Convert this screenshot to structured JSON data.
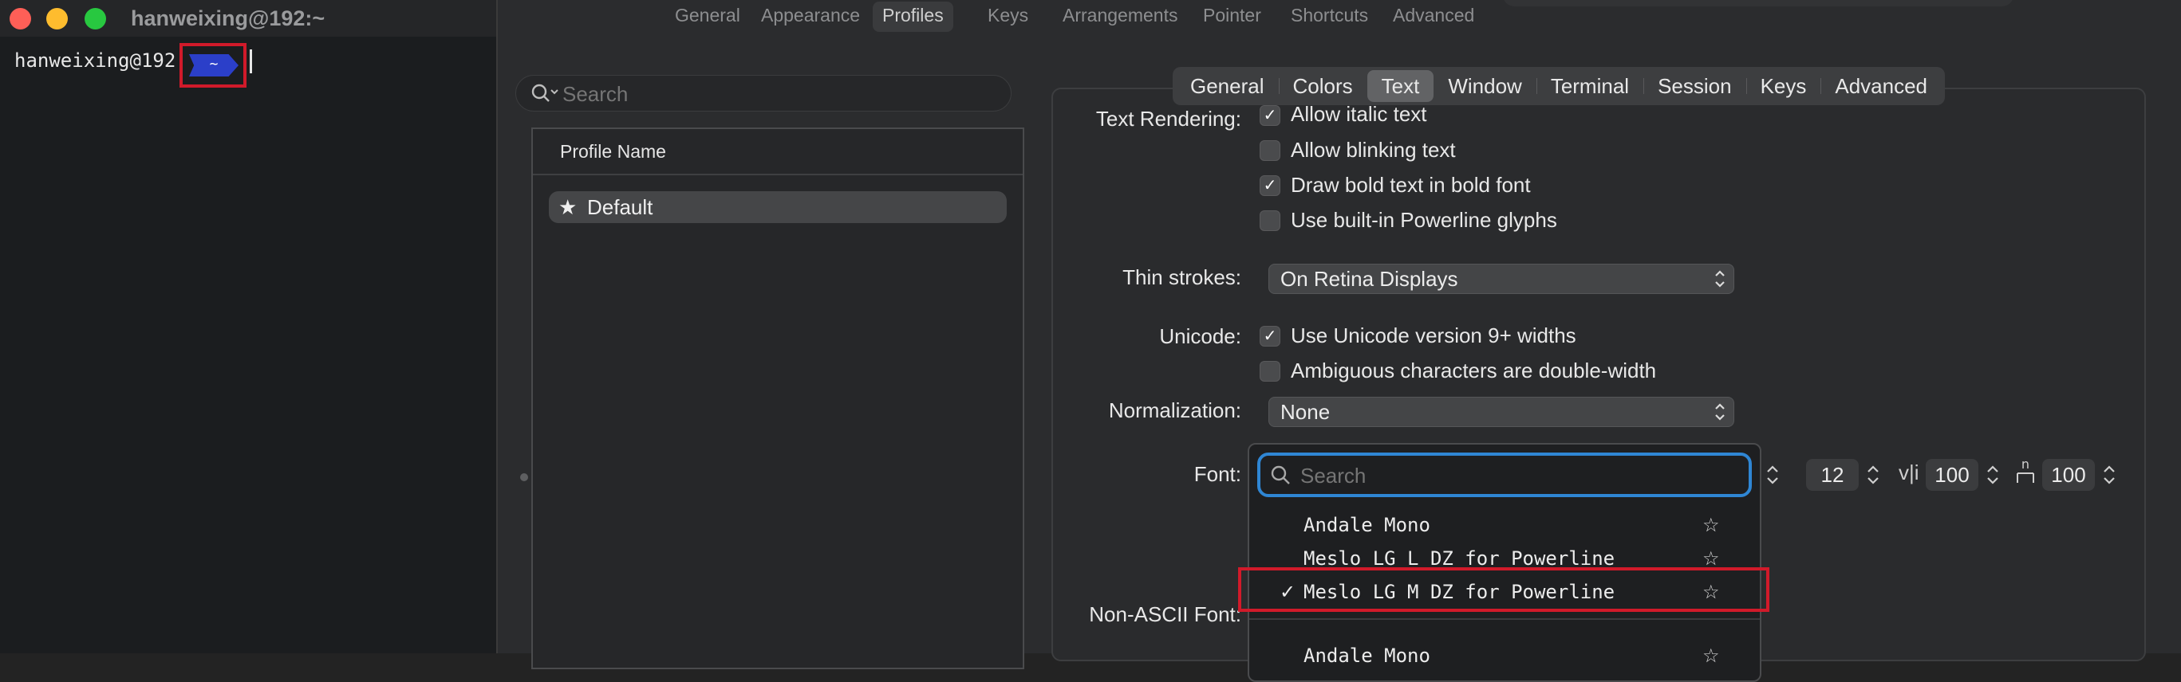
{
  "terminal": {
    "title": "hanweixing@192:~",
    "prompt_user": "hanweixing@192",
    "prompt_segment": "~"
  },
  "prefs": {
    "top_tabs": [
      {
        "label": "General"
      },
      {
        "label": "Appearance"
      },
      {
        "label": "Profiles",
        "active": true
      },
      {
        "label": "Keys"
      },
      {
        "label": "Arrangements"
      },
      {
        "label": "Pointer"
      },
      {
        "label": "Shortcuts"
      },
      {
        "label": "Advanced"
      }
    ],
    "profiles": {
      "search_placeholder": "Search",
      "column_header": "Profile Name",
      "default_profile": "Default"
    },
    "profile_tabs": [
      {
        "label": "General"
      },
      {
        "label": "Colors"
      },
      {
        "label": "Text",
        "active": true
      },
      {
        "label": "Window"
      },
      {
        "label": "Terminal"
      },
      {
        "label": "Session"
      },
      {
        "label": "Keys"
      },
      {
        "label": "Advanced"
      }
    ],
    "text": {
      "text_rendering_label": "Text Rendering:",
      "allow_italic": {
        "label": "Allow italic text",
        "checked": true
      },
      "allow_blinking": {
        "label": "Allow blinking text",
        "checked": false
      },
      "bold_font": {
        "label": "Draw bold text in bold font",
        "checked": true
      },
      "powerline": {
        "label": "Use built-in Powerline glyphs",
        "checked": false
      },
      "thin_strokes_label": "Thin strokes:",
      "thin_strokes_value": "On Retina Displays",
      "unicode_label": "Unicode:",
      "unicode_widths": {
        "label": "Use Unicode version 9+ widths",
        "checked": true
      },
      "ambiguous": {
        "label": "Ambiguous characters are double-width",
        "checked": false
      },
      "normalization_label": "Normalization:",
      "normalization_value": "None",
      "font_label": "Font:",
      "font_size": "12",
      "vertical_spacing": "100",
      "horizontal_spacing": "100",
      "non_ascii_label": "Non-ASCII Font:"
    },
    "font_menu": {
      "search_placeholder": "Search",
      "items": [
        {
          "name": "Andale Mono",
          "selected": false
        },
        {
          "name": "Meslo LG L DZ for Powerline",
          "selected": false
        },
        {
          "name": "Meslo LG M DZ for Powerline",
          "selected": true
        },
        {
          "name": "Andale Mono",
          "selected": false
        }
      ]
    }
  },
  "colors": {
    "highlight_red": "#d11a2a",
    "focus_blue": "#2f86d4",
    "powerline_blue": "#2b3fc9"
  }
}
